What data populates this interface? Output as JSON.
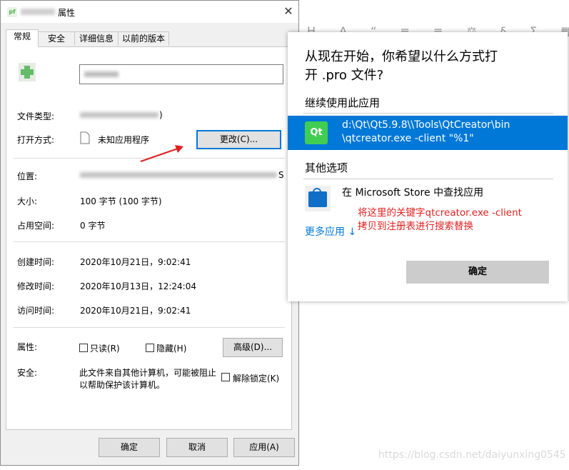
{
  "background": {
    "toolbar_glyphs": "H A  “  ≡  ≡  ⚖  §  Σ  ▦  ¦",
    "watermark": "https://blog.csdn.net/daiyunxing0545"
  },
  "properties_window": {
    "title": "属性",
    "tabs": [
      {
        "label": "常规",
        "active": true
      },
      {
        "label": "安全",
        "active": false
      },
      {
        "label": "详细信息",
        "active": false
      },
      {
        "label": "以前的版本",
        "active": false
      }
    ],
    "fields": {
      "file_type_label": "文件类型:",
      "file_type_tail": ")",
      "open_with_label": "打开方式:",
      "open_with_value": "未知应用程序",
      "change_button": "更改(C)...",
      "location_label": "位置:",
      "location_tail": "S",
      "size_label": "大小:",
      "size_value": "100 字节 (100 字节)",
      "disk_size_label": "占用空间:",
      "disk_size_value": "0 字节",
      "created_label": "创建时间:",
      "created_value": "2020年10月21日，9:02:41",
      "modified_label": "修改时间:",
      "modified_value": "2020年10月13日，12:24:04",
      "accessed_label": "访问时间:",
      "accessed_value": "2020年10月21日，9:02:41",
      "attributes_label": "属性:",
      "readonly_label": "只读(R)",
      "hidden_label": "隐藏(H)",
      "advanced_button": "高级(D)...",
      "security_label": "安全:",
      "security_text_1": "此文件来自其他计算机，可能被阻止",
      "security_text_2": "以帮助保护该计算机。",
      "unblock_label": "解除锁定(K)"
    },
    "buttons": {
      "ok": "确定",
      "cancel": "取消",
      "apply": "应用(A)"
    }
  },
  "open_with_dialog": {
    "question_line1": "从现在开始，你希望以什么方式打",
    "question_line2": "开 .pro 文件?",
    "keep_using_heading": "继续使用此应用",
    "app_icon_text": "Qt",
    "app_path_line1": "d:\\Qt\\Qt5.9.8\\\\Tools\\QtCreator\\bin",
    "app_path_line2": "\\qtcreator.exe -client \"%1\"",
    "other_options_heading": "其他选项",
    "store_option": "在 Microsoft Store 中查找应用",
    "more_apps": "更多应用",
    "more_apps_arrow": "↓",
    "annotation_line1": "将这里的关键字qtcreator.exe -client",
    "annotation_line2": "拷贝到注册表进行搜索替换",
    "ok_button": "确定"
  },
  "colors": {
    "accent": "#0078d7",
    "annotation": "#e02020",
    "qt_green": "#41cd52"
  }
}
